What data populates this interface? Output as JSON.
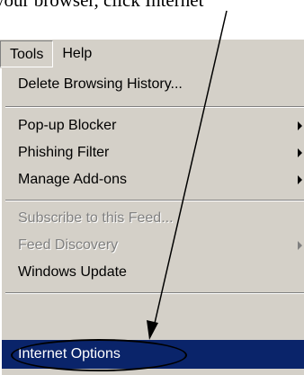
{
  "caption": "your browser, click Internet",
  "menubar": {
    "items": [
      {
        "label": "Tools"
      },
      {
        "label": "Help"
      }
    ]
  },
  "menu": {
    "items": [
      {
        "label": "Delete Browsing History..."
      },
      {
        "label": "Pop-up Blocker"
      },
      {
        "label": "Phishing Filter"
      },
      {
        "label": "Manage Add-ons"
      },
      {
        "label": "Subscribe to this Feed..."
      },
      {
        "label": "Feed Discovery"
      },
      {
        "label": "Windows Update"
      },
      {
        "label": "Internet Options"
      }
    ]
  },
  "colors": {
    "menu_background": "#d4d0c8",
    "highlight": "#0a246a",
    "disabled_text": "#808080"
  },
  "icons": {
    "submenu": "submenu-arrow-icon",
    "annotation": "annotation-arrow-icon"
  }
}
